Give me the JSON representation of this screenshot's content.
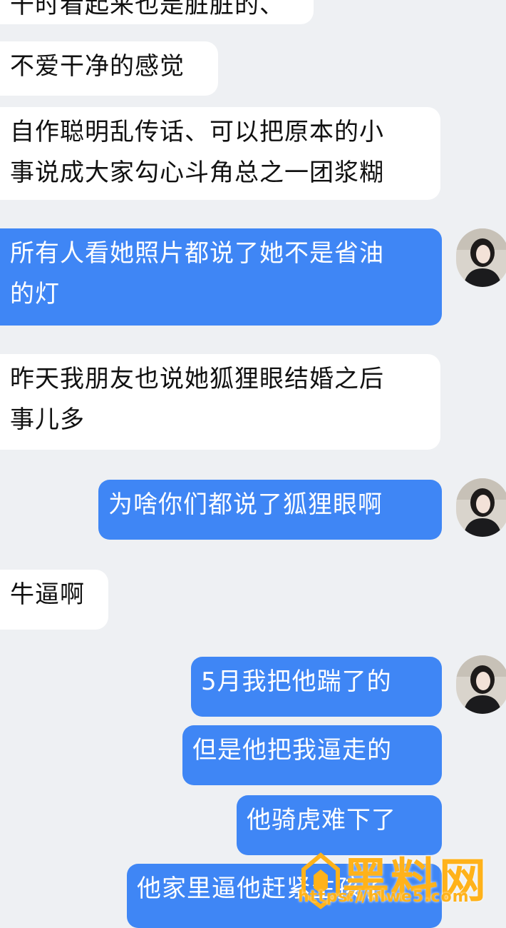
{
  "messages": {
    "m0": "干时看起来也是脏脏的、",
    "m1": "不爱干净的感觉",
    "m2": "自作聪明乱传话、可以把原本的小\n事说成大家勾心斗角总之一团浆糊",
    "m3": "所有人看她照片都说了她不是省油\n的灯",
    "m4": "昨天我朋友也说她狐狸眼结婚之后\n事儿多",
    "m5": "为啥你们都说了狐狸眼啊",
    "m6": "牛逼啊",
    "m7": "5月我把他踹了的",
    "m8": "但是他把我逼走的",
    "m9": "他骑虎难下了",
    "m10": "他家里逼他赶紧生孩子"
  },
  "watermark": {
    "brand": "黑料网",
    "url": "https://hlwe5.com"
  },
  "colors": {
    "background": "#eef0f3",
    "incoming_bubble": "#ffffff",
    "outgoing_bubble": "#3f86f5",
    "watermark": "#ffb21a"
  }
}
